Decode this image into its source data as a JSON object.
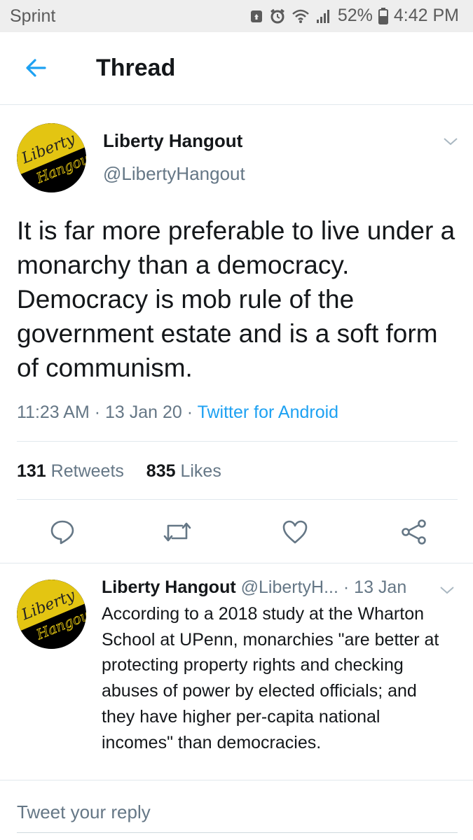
{
  "status_bar": {
    "carrier": "Sprint",
    "battery": "52%",
    "time": "4:42 PM"
  },
  "header": {
    "title": "Thread"
  },
  "tweet": {
    "display_name": "Liberty Hangout",
    "handle": "@LibertyHangout",
    "avatar_text": [
      "Liberty",
      "Hangout"
    ],
    "text": "It is far more preferable to live under a monarchy than a democracy. Democracy is mob rule of the government estate and is a soft form of communism.",
    "time": "11:23 AM",
    "date": "13 Jan 20",
    "separator": " · ",
    "source": "Twitter for Android",
    "retweets_count": "131",
    "retweets_label": "Retweets",
    "likes_count": "835",
    "likes_label": "Likes"
  },
  "reply": {
    "display_name": "Liberty Hangout",
    "handle": "@LibertyH...",
    "date": "· 13 Jan",
    "text": "According to a 2018 study at the Wharton School at UPenn, monarchies \"are better at protecting property rights and checking abuses of power by elected officials; and they have higher per-capita national incomes\" than democracies."
  },
  "compose": {
    "placeholder": "Tweet your reply"
  },
  "icons": {
    "back": "arrow-left-icon",
    "reply": "reply-icon",
    "retweet": "retweet-icon",
    "like": "heart-icon",
    "share": "share-icon",
    "more": "chevron-down-icon"
  },
  "colors": {
    "accent": "#1da1f2",
    "secondary_text": "#657786",
    "primary_text": "#14171a",
    "avatar_gold": "#e3c512"
  }
}
